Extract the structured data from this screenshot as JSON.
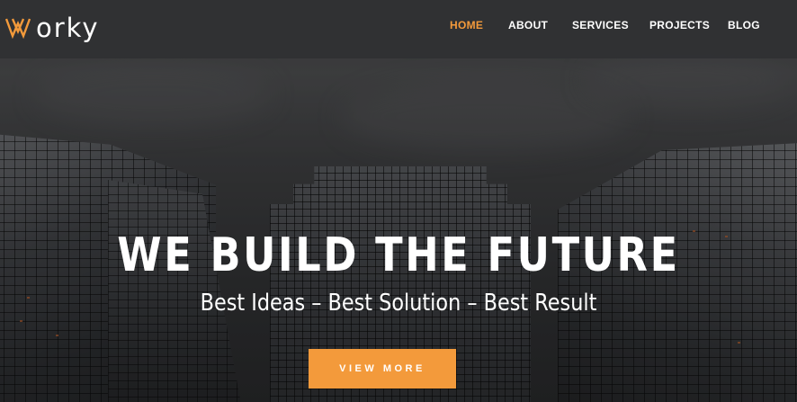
{
  "brand": {
    "logo_text": "orky",
    "logo_mark_icon": "w-chevron-logo-icon",
    "accent_color": "#f39a3b"
  },
  "nav": {
    "items": [
      {
        "label": "HOME",
        "active": true
      },
      {
        "label": "ABOUT",
        "active": false
      },
      {
        "label": "SERVICES",
        "active": false
      },
      {
        "label": "PROJECTS",
        "active": false
      },
      {
        "label": "BLOG",
        "active": false
      }
    ]
  },
  "hero": {
    "title": "WE BUILD THE FUTURE",
    "subtitle": "Best Ideas – Best Solution – Best Result",
    "cta_label": "VIEW MORE"
  }
}
